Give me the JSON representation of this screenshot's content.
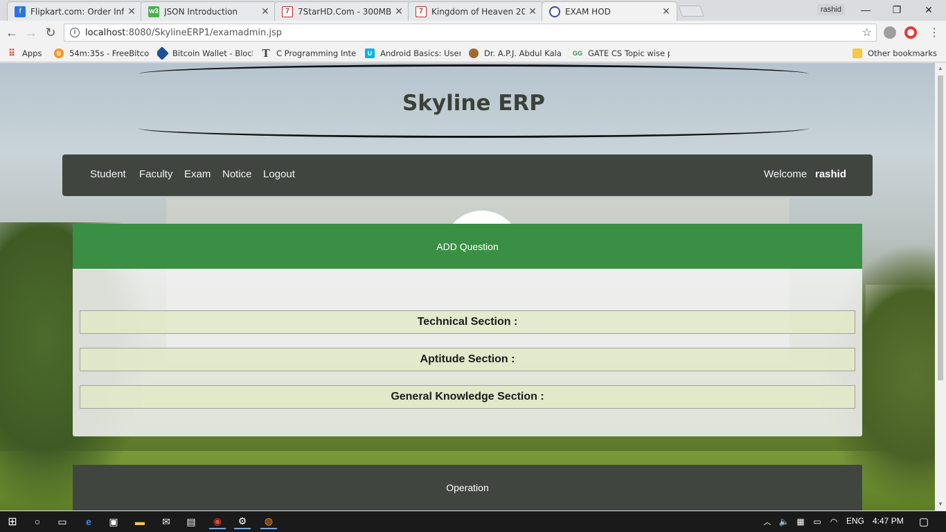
{
  "browser": {
    "tabs": [
      {
        "title": "Flipkart.com: Order Inform",
        "favicon": "flipkart-icon",
        "active": false
      },
      {
        "title": "JSON Introduction",
        "favicon": "w3schools-icon",
        "active": false
      },
      {
        "title": "7StarHD.Com - 300MB Du",
        "favicon": "7starhd-icon",
        "active": false
      },
      {
        "title": "Kingdom of Heaven 2005",
        "favicon": "7starhd-icon",
        "active": false
      },
      {
        "title": "EXAM HOD",
        "favicon": "globe-icon",
        "active": true
      }
    ],
    "profile_name": "rashid",
    "url_host": "localhost",
    "url_path": ":8080/SkylineERP1/examadmin.jsp",
    "bookmarks": [
      {
        "label": "Apps",
        "icon": "apps-grid-icon"
      },
      {
        "label": "54m:35s - FreeBitco",
        "icon": "bitcoin-icon"
      },
      {
        "label": "Bitcoin Wallet - Block",
        "icon": "blockchain-icon"
      },
      {
        "label": "C Programming Inte",
        "icon": "type-icon"
      },
      {
        "label": "Android Basics: User",
        "icon": "udacity-icon"
      },
      {
        "label": "Dr. A.P.J. Abdul Kala",
        "icon": "seal-icon"
      },
      {
        "label": "GATE CS Topic wise p",
        "icon": "geeksforgeeks-icon"
      },
      {
        "label": "Other bookmarks",
        "icon": "folder-icon"
      }
    ]
  },
  "page": {
    "site_title": "Skyline ERP",
    "nav": {
      "links": [
        "Student",
        "Faculty",
        "Exam",
        "Notice",
        "Logout"
      ],
      "welcome": "Welcome",
      "username": "rashid"
    },
    "panel": {
      "header": "ADD Question",
      "sections": [
        "Technical Section :",
        "Aptitude Section :",
        "General Knowledge Section :"
      ]
    },
    "operation_label": "Operation",
    "colors": {
      "nav_bg": "#404540",
      "panel_header": "#3a8f44",
      "section_bg": "#e0e9c6"
    }
  },
  "taskbar": {
    "language": "ENG",
    "time": "4:47 PM"
  }
}
